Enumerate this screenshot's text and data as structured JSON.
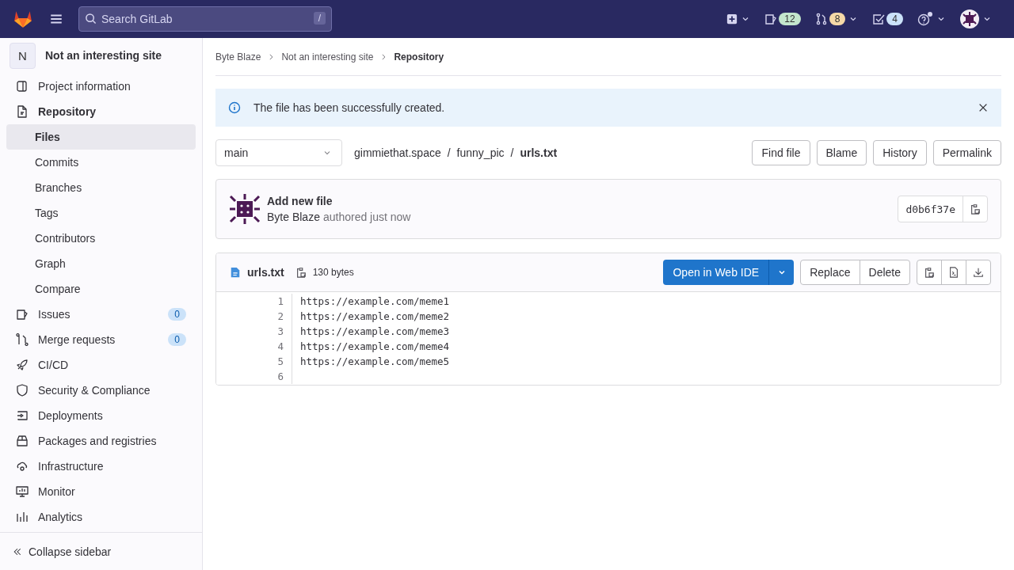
{
  "topbar": {
    "search": {
      "placeholder": "Search GitLab",
      "shortcut": "/"
    },
    "counters": [
      {
        "kind": "issues",
        "count": "12",
        "color": "#c3e6cd"
      },
      {
        "kind": "merge",
        "count": "8",
        "color": "#f5d9a8"
      },
      {
        "kind": "todo",
        "count": "4",
        "color": "#cbe2f9"
      }
    ]
  },
  "sidebar": {
    "project": {
      "initial": "N",
      "name": "Not an interesting site"
    },
    "items": [
      {
        "label": "Project information",
        "selected": false
      },
      {
        "label": "Repository",
        "selected": false,
        "expanded": true,
        "children": [
          {
            "label": "Files",
            "selected": true
          },
          {
            "label": "Commits",
            "selected": false
          },
          {
            "label": "Branches",
            "selected": false
          },
          {
            "label": "Tags",
            "selected": false
          },
          {
            "label": "Contributors",
            "selected": false
          },
          {
            "label": "Graph",
            "selected": false
          },
          {
            "label": "Compare",
            "selected": false
          }
        ]
      },
      {
        "label": "Issues",
        "selected": false,
        "count": "0"
      },
      {
        "label": "Merge requests",
        "selected": false,
        "count": "0"
      },
      {
        "label": "CI/CD",
        "selected": false
      },
      {
        "label": "Security & Compliance",
        "selected": false
      },
      {
        "label": "Deployments",
        "selected": false
      },
      {
        "label": "Packages and registries",
        "selected": false
      },
      {
        "label": "Infrastructure",
        "selected": false
      },
      {
        "label": "Monitor",
        "selected": false
      },
      {
        "label": "Analytics",
        "selected": false
      }
    ],
    "collapse": "Collapse sidebar"
  },
  "breadcrumbs": [
    "Byte Blaze",
    "Not an interesting site",
    "Repository"
  ],
  "alert": {
    "text": "The file has been successfully created."
  },
  "branch": "main",
  "path": [
    "gimmiethat.space",
    "funny_pic",
    "urls.txt"
  ],
  "path_separator": "/",
  "actions": [
    "Find file",
    "Blame",
    "History",
    "Permalink"
  ],
  "commit": {
    "title": "Add new file",
    "author": "Byte Blaze",
    "when": "authored just now",
    "sha": "d0b6f37e"
  },
  "file": {
    "name": "urls.txt",
    "size": "130 bytes",
    "primary": "Open in Web IDE",
    "buttons": [
      "Replace",
      "Delete"
    ],
    "lines": [
      {
        "number": "1",
        "text": "https://example.com/meme1"
      },
      {
        "number": "2",
        "text": "https://example.com/meme2"
      },
      {
        "number": "3",
        "text": "https://example.com/meme3"
      },
      {
        "number": "4",
        "text": "https://example.com/meme4"
      },
      {
        "number": "5",
        "text": "https://example.com/meme5"
      },
      {
        "number": "6"
      }
    ]
  }
}
